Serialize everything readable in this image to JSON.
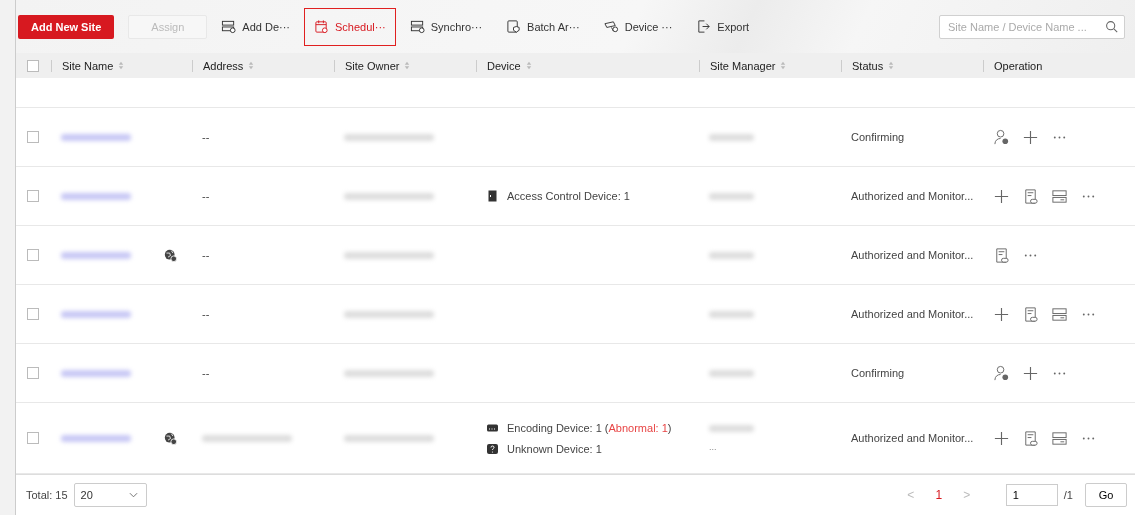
{
  "toolbar": {
    "primary": {
      "label": "Add New Site"
    },
    "assign": {
      "label": "Assign",
      "disabled": true
    },
    "actions": [
      {
        "kind": "add-device",
        "label": "Add De···",
        "selected": false
      },
      {
        "kind": "schedule",
        "label": "Schedul···",
        "selected": true
      },
      {
        "kind": "sync",
        "label": "Synchro···",
        "selected": false
      },
      {
        "kind": "batch",
        "label": "Batch Ar···",
        "selected": false
      },
      {
        "kind": "device",
        "label": "Device ···",
        "selected": false
      },
      {
        "kind": "export",
        "label": "Export",
        "selected": false
      }
    ],
    "search": {
      "placeholder": "Site Name / Device Name ..."
    }
  },
  "table": {
    "select_all": {
      "checked": false
    },
    "columns": [
      {
        "label": "Site Name",
        "sortable": true
      },
      {
        "label": "Address",
        "sortable": true
      },
      {
        "label": "Site Owner",
        "sortable": true
      },
      {
        "label": "Device",
        "sortable": true
      },
      {
        "label": "Site Manager",
        "sortable": true
      },
      {
        "label": "Status",
        "sortable": true
      },
      {
        "label": "Operation",
        "sortable": false
      }
    ],
    "rows": [
      {
        "checked": false,
        "address": "--",
        "devices": [],
        "status": "Confirming",
        "operations": [
          {
            "kind": "assign-user"
          },
          {
            "kind": "add"
          },
          {
            "kind": "more"
          }
        ]
      },
      {
        "checked": false,
        "address": "--",
        "devices": [
          {
            "kind": "access",
            "segments": [
              {
                "text": "Access Control Device: 1",
                "alert": false
              }
            ]
          }
        ],
        "status": "Authorized and Monitor...",
        "operations": [
          {
            "kind": "add"
          },
          {
            "kind": "link"
          },
          {
            "kind": "device"
          },
          {
            "kind": "more"
          }
        ]
      },
      {
        "checked": false,
        "site_icon": {
          "kind": "globe"
        },
        "address": "--",
        "devices": [],
        "status": "Authorized and Monitor...",
        "operations": [
          {
            "kind": "link"
          },
          {
            "kind": "more"
          }
        ]
      },
      {
        "checked": false,
        "address": "--",
        "devices": [],
        "status": "Authorized and Monitor...",
        "operations": [
          {
            "kind": "add"
          },
          {
            "kind": "link"
          },
          {
            "kind": "device"
          },
          {
            "kind": "more"
          }
        ]
      },
      {
        "checked": false,
        "address": "--",
        "devices": [],
        "status": "Confirming",
        "operations": [
          {
            "kind": "assign-user"
          },
          {
            "kind": "add"
          },
          {
            "kind": "more"
          }
        ]
      },
      {
        "checked": false,
        "site_icon": {
          "kind": "globe"
        },
        "devices": [
          {
            "kind": "encoding",
            "segments": [
              {
                "text": "Encoding Device: 1 (",
                "alert": false
              },
              {
                "text": "Abnormal: 1",
                "alert": true
              },
              {
                "text": ")",
                "alert": false
              }
            ]
          },
          {
            "kind": "unknown",
            "segments": [
              {
                "text": "Unknown Device: 1",
                "alert": false
              }
            ]
          }
        ],
        "manager_more": "...",
        "status": "Authorized and Monitor...",
        "operations": [
          {
            "kind": "add"
          },
          {
            "kind": "link"
          },
          {
            "kind": "device"
          },
          {
            "kind": "more"
          }
        ]
      }
    ]
  },
  "footer": {
    "total": "Total: 15",
    "page_size": "20",
    "prev": "<",
    "pages": [
      {
        "label": "1",
        "selected": true
      }
    ],
    "next": ">",
    "page_input": "1",
    "page_count": "/1",
    "go": "Go"
  }
}
